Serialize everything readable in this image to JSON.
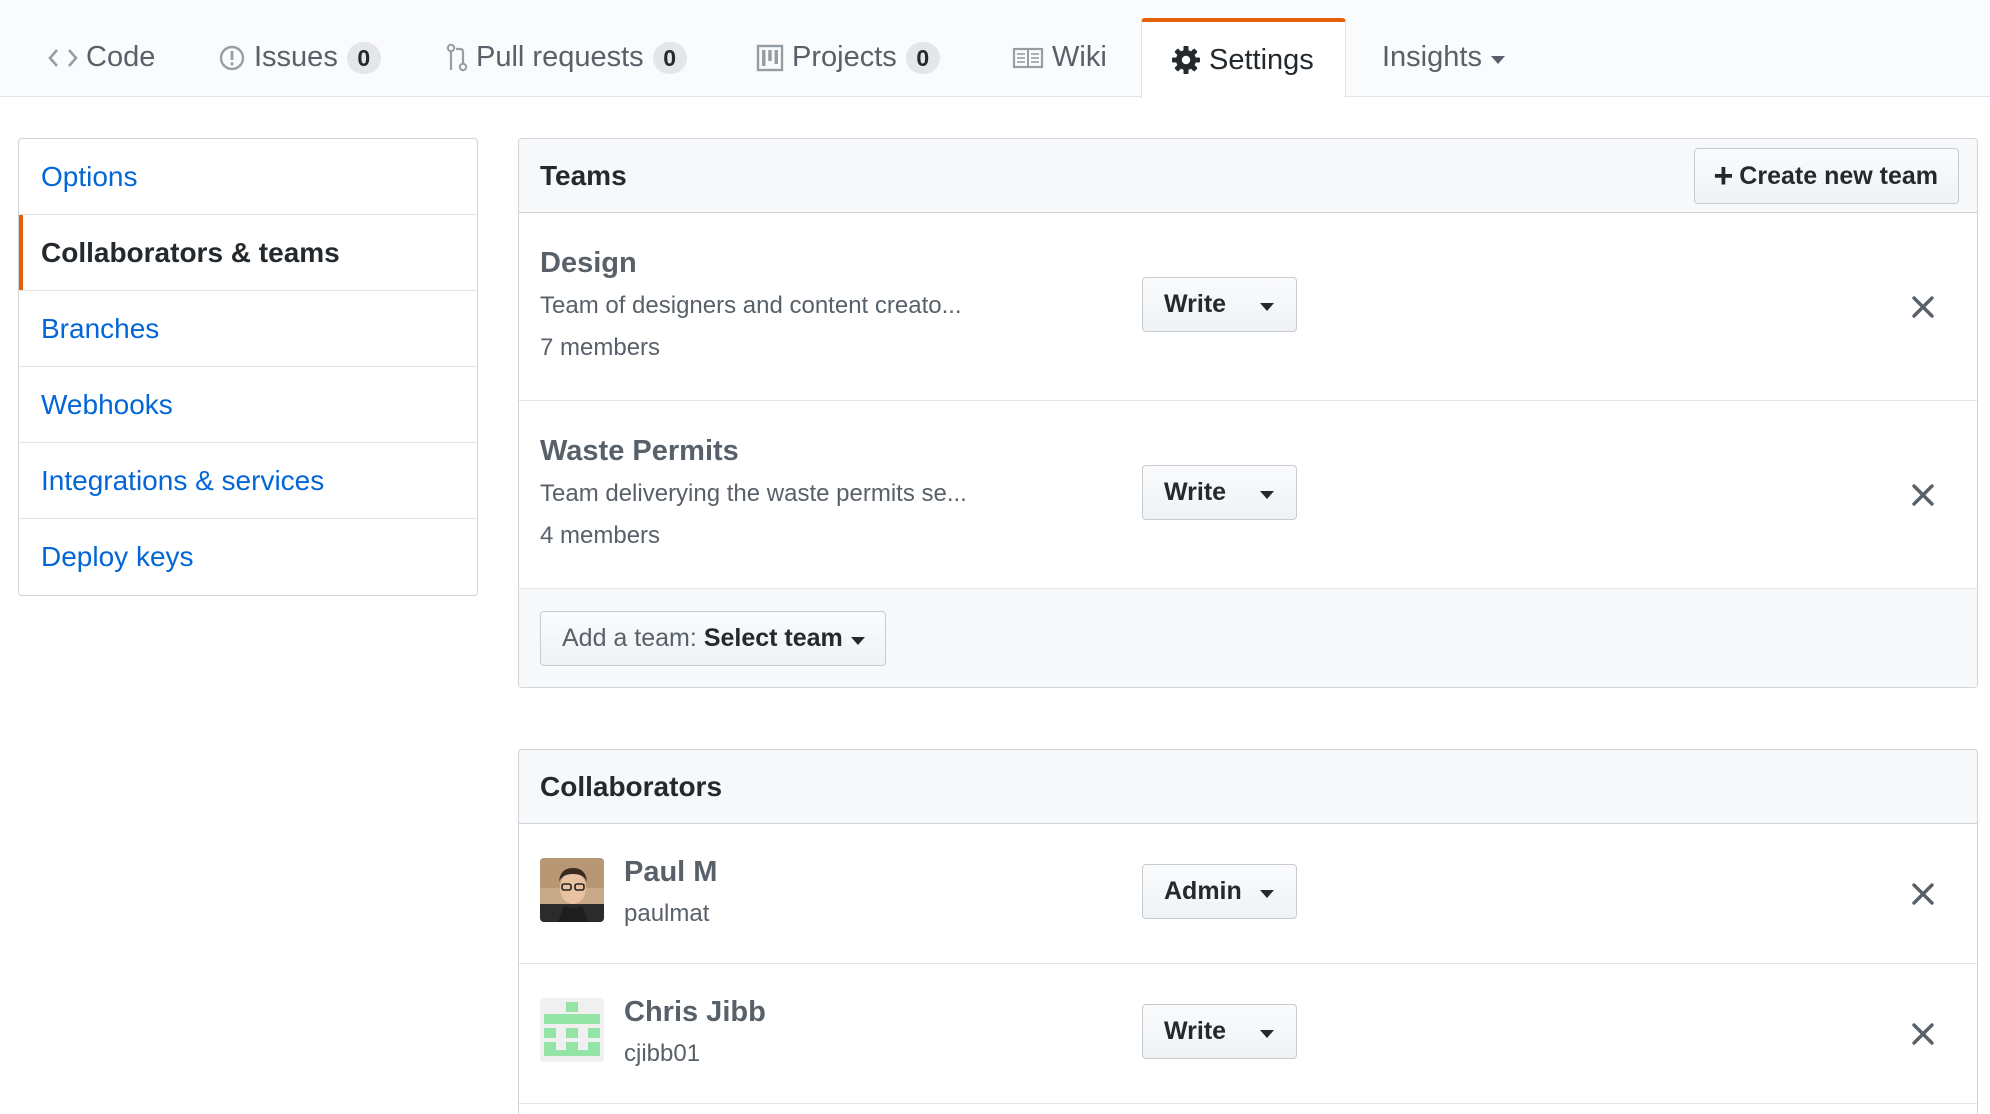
{
  "tabnav": {
    "tabs": [
      {
        "label": "Code",
        "icon": "code-icon",
        "counter": null
      },
      {
        "label": "Issues",
        "icon": "issue-icon",
        "counter": "0"
      },
      {
        "label": "Pull requests",
        "icon": "pull-request-icon",
        "counter": "0"
      },
      {
        "label": "Projects",
        "icon": "project-icon",
        "counter": "0"
      },
      {
        "label": "Wiki",
        "icon": "book-icon",
        "counter": null
      },
      {
        "label": "Settings",
        "icon": "gear-icon",
        "counter": null,
        "selected": true
      },
      {
        "label": "Insights",
        "icon": null,
        "counter": null,
        "dropdown": true
      }
    ]
  },
  "menu": {
    "items": [
      {
        "label": "Options"
      },
      {
        "label": "Collaborators & teams",
        "selected": true
      },
      {
        "label": "Branches"
      },
      {
        "label": "Webhooks"
      },
      {
        "label": "Integrations & services"
      },
      {
        "label": "Deploy keys"
      }
    ]
  },
  "teams": {
    "title": "Teams",
    "create_label": "Create new team",
    "items": [
      {
        "name": "Design",
        "description": "Team of designers and content creato...",
        "members": "7 members",
        "permission": "Write"
      },
      {
        "name": "Waste Permits",
        "description": "Team deliverying the waste permits se...",
        "members": "4 members",
        "permission": "Write"
      }
    ],
    "add_label": "Add a team:",
    "select_label": "Select team"
  },
  "collaborators": {
    "title": "Collaborators",
    "items": [
      {
        "name": "Paul M",
        "login": "paulmat",
        "permission": "Admin",
        "avatar": "photo-avatar"
      },
      {
        "name": "Chris Jibb",
        "login": "cjibb01",
        "permission": "Write",
        "avatar": "identicon-avatar"
      }
    ]
  },
  "colors": {
    "accent": "#e36209",
    "link": "#0366d6",
    "identicon": "#95e4a7"
  }
}
